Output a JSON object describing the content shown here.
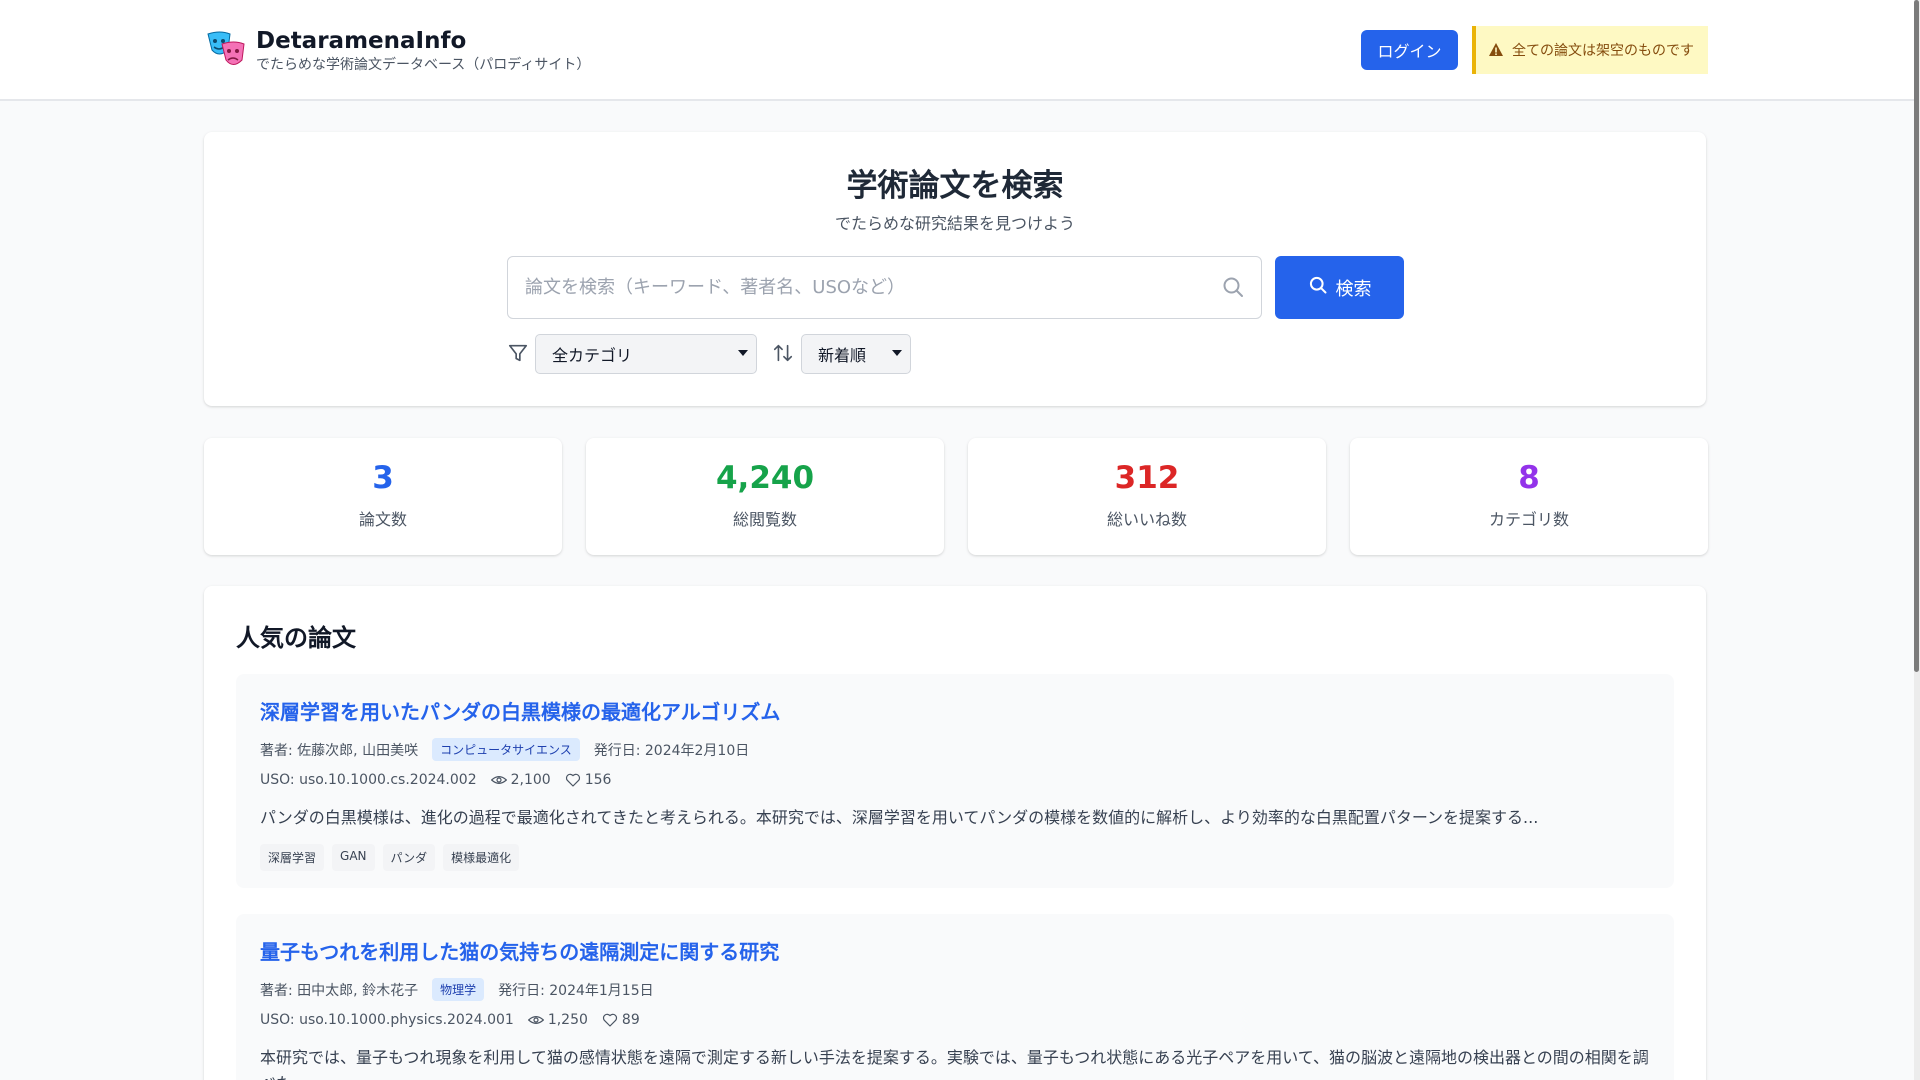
{
  "header": {
    "brand_title": "DetaramenaInfo",
    "brand_subtitle": "でたらめな学術論文データベース（パロディサイト）",
    "login_label": "ログイン",
    "disclaimer": "全ての論文は架空のものです"
  },
  "search": {
    "title": "学術論文を検索",
    "subtitle": "でたらめな研究結果を見つけよう",
    "placeholder": "論文を検索（キーワード、著者名、USOなど）",
    "button_label": "検索",
    "category_value": "全カテゴリ",
    "sort_value": "新着順"
  },
  "stats": [
    {
      "value": "3",
      "label": "論文数",
      "color": "#2563eb"
    },
    {
      "value": "4,240",
      "label": "総閲覧数",
      "color": "#16a34a"
    },
    {
      "value": "312",
      "label": "総いいね数",
      "color": "#dc2626"
    },
    {
      "value": "8",
      "label": "カテゴリ数",
      "color": "#9333ea"
    }
  ],
  "popular": {
    "title": "人気の論文",
    "papers": [
      {
        "title": "深層学習を用いたパンダの白黒模様の最適化アルゴリズム",
        "authors": "著者: 佐藤次郎, 山田美咲",
        "category": "コンピュータサイエンス",
        "published": "発行日: 2024年2月10日",
        "uso": "USO: uso.10.1000.cs.2024.002",
        "views": "2,100",
        "likes": "156",
        "abstract": "パンダの白黒模様は、進化の過程で最適化されてきたと考えられる。本研究では、深層学習を用いてパンダの模様を数値的に解析し、より効率的な白黒配置パターンを提案する...",
        "tags": [
          "深層学習",
          "GAN",
          "パンダ",
          "模様最適化"
        ]
      },
      {
        "title": "量子もつれを利用した猫の気持ちの遠隔測定に関する研究",
        "authors": "著者: 田中太郎, 鈴木花子",
        "category": "物理学",
        "published": "発行日: 2024年1月15日",
        "uso": "USO: uso.10.1000.physics.2024.001",
        "views": "1,250",
        "likes": "89",
        "abstract": "本研究では、量子もつれ現象を利用して猫の感情状態を遠隔で測定する新しい手法を提案する。実験では、量子もつれ状態にある光子ペアを用いて、猫の脳波と遠隔地の検出器との間の相関を調べた。"
      }
    ]
  }
}
